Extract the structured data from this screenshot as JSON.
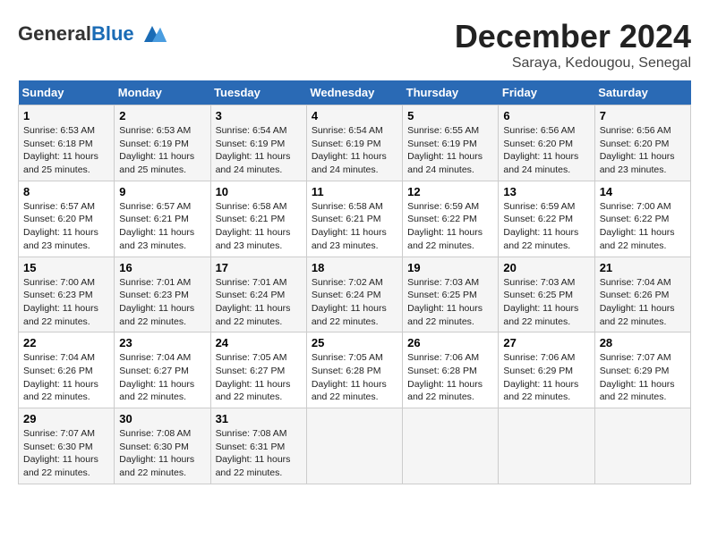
{
  "logo": {
    "general": "General",
    "blue": "Blue"
  },
  "header": {
    "month": "December 2024",
    "location": "Saraya, Kedougou, Senegal"
  },
  "days_of_week": [
    "Sunday",
    "Monday",
    "Tuesday",
    "Wednesday",
    "Thursday",
    "Friday",
    "Saturday"
  ],
  "weeks": [
    [
      {
        "day": "1",
        "sunrise": "6:53 AM",
        "sunset": "6:18 PM",
        "daylight": "11 hours and 25 minutes."
      },
      {
        "day": "2",
        "sunrise": "6:53 AM",
        "sunset": "6:19 PM",
        "daylight": "11 hours and 25 minutes."
      },
      {
        "day": "3",
        "sunrise": "6:54 AM",
        "sunset": "6:19 PM",
        "daylight": "11 hours and 24 minutes."
      },
      {
        "day": "4",
        "sunrise": "6:54 AM",
        "sunset": "6:19 PM",
        "daylight": "11 hours and 24 minutes."
      },
      {
        "day": "5",
        "sunrise": "6:55 AM",
        "sunset": "6:19 PM",
        "daylight": "11 hours and 24 minutes."
      },
      {
        "day": "6",
        "sunrise": "6:56 AM",
        "sunset": "6:20 PM",
        "daylight": "11 hours and 24 minutes."
      },
      {
        "day": "7",
        "sunrise": "6:56 AM",
        "sunset": "6:20 PM",
        "daylight": "11 hours and 23 minutes."
      }
    ],
    [
      {
        "day": "8",
        "sunrise": "6:57 AM",
        "sunset": "6:20 PM",
        "daylight": "11 hours and 23 minutes."
      },
      {
        "day": "9",
        "sunrise": "6:57 AM",
        "sunset": "6:21 PM",
        "daylight": "11 hours and 23 minutes."
      },
      {
        "day": "10",
        "sunrise": "6:58 AM",
        "sunset": "6:21 PM",
        "daylight": "11 hours and 23 minutes."
      },
      {
        "day": "11",
        "sunrise": "6:58 AM",
        "sunset": "6:21 PM",
        "daylight": "11 hours and 23 minutes."
      },
      {
        "day": "12",
        "sunrise": "6:59 AM",
        "sunset": "6:22 PM",
        "daylight": "11 hours and 22 minutes."
      },
      {
        "day": "13",
        "sunrise": "6:59 AM",
        "sunset": "6:22 PM",
        "daylight": "11 hours and 22 minutes."
      },
      {
        "day": "14",
        "sunrise": "7:00 AM",
        "sunset": "6:22 PM",
        "daylight": "11 hours and 22 minutes."
      }
    ],
    [
      {
        "day": "15",
        "sunrise": "7:00 AM",
        "sunset": "6:23 PM",
        "daylight": "11 hours and 22 minutes."
      },
      {
        "day": "16",
        "sunrise": "7:01 AM",
        "sunset": "6:23 PM",
        "daylight": "11 hours and 22 minutes."
      },
      {
        "day": "17",
        "sunrise": "7:01 AM",
        "sunset": "6:24 PM",
        "daylight": "11 hours and 22 minutes."
      },
      {
        "day": "18",
        "sunrise": "7:02 AM",
        "sunset": "6:24 PM",
        "daylight": "11 hours and 22 minutes."
      },
      {
        "day": "19",
        "sunrise": "7:03 AM",
        "sunset": "6:25 PM",
        "daylight": "11 hours and 22 minutes."
      },
      {
        "day": "20",
        "sunrise": "7:03 AM",
        "sunset": "6:25 PM",
        "daylight": "11 hours and 22 minutes."
      },
      {
        "day": "21",
        "sunrise": "7:04 AM",
        "sunset": "6:26 PM",
        "daylight": "11 hours and 22 minutes."
      }
    ],
    [
      {
        "day": "22",
        "sunrise": "7:04 AM",
        "sunset": "6:26 PM",
        "daylight": "11 hours and 22 minutes."
      },
      {
        "day": "23",
        "sunrise": "7:04 AM",
        "sunset": "6:27 PM",
        "daylight": "11 hours and 22 minutes."
      },
      {
        "day": "24",
        "sunrise": "7:05 AM",
        "sunset": "6:27 PM",
        "daylight": "11 hours and 22 minutes."
      },
      {
        "day": "25",
        "sunrise": "7:05 AM",
        "sunset": "6:28 PM",
        "daylight": "11 hours and 22 minutes."
      },
      {
        "day": "26",
        "sunrise": "7:06 AM",
        "sunset": "6:28 PM",
        "daylight": "11 hours and 22 minutes."
      },
      {
        "day": "27",
        "sunrise": "7:06 AM",
        "sunset": "6:29 PM",
        "daylight": "11 hours and 22 minutes."
      },
      {
        "day": "28",
        "sunrise": "7:07 AM",
        "sunset": "6:29 PM",
        "daylight": "11 hours and 22 minutes."
      }
    ],
    [
      {
        "day": "29",
        "sunrise": "7:07 AM",
        "sunset": "6:30 PM",
        "daylight": "11 hours and 22 minutes."
      },
      {
        "day": "30",
        "sunrise": "7:08 AM",
        "sunset": "6:30 PM",
        "daylight": "11 hours and 22 minutes."
      },
      {
        "day": "31",
        "sunrise": "7:08 AM",
        "sunset": "6:31 PM",
        "daylight": "11 hours and 22 minutes."
      },
      null,
      null,
      null,
      null
    ]
  ]
}
